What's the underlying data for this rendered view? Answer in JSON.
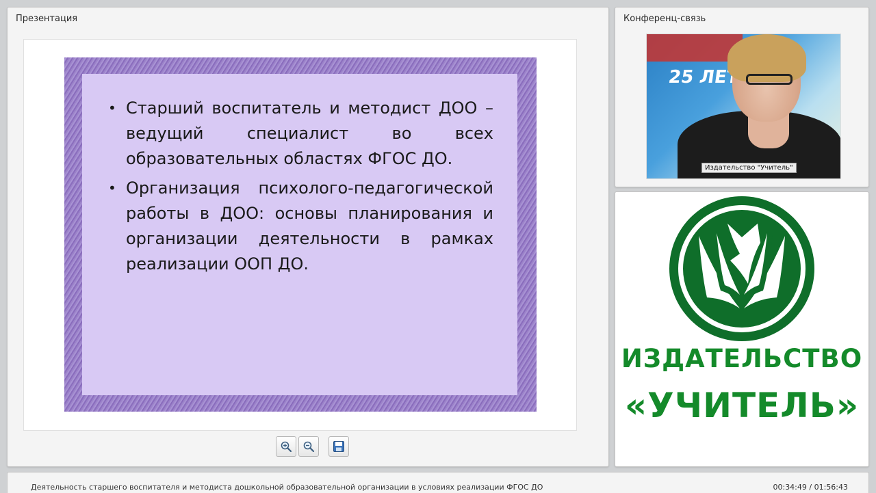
{
  "presentation": {
    "title": "Презентация",
    "slide": {
      "bullets": [
        "Старший воспитатель и методист ДОО – ведущий специалист во всех образовательных областях ФГОС ДО.",
        "Организация психолого-педагогической работы в ДОО: основы планирования и организации деятельности в рамках реализации ООП ДО."
      ]
    },
    "toolbar": {
      "zoom_in_icon": "zoom-in-icon",
      "zoom_out_icon": "zoom-out-icon",
      "save_icon": "floppy-disk-icon"
    }
  },
  "conference": {
    "title": "Конференц-связь",
    "video_banner": "25 ЛЕТ",
    "video_caption": "Издательство \"Учитель\""
  },
  "logo": {
    "line1": "ИЗДАТЕЛЬСТВО",
    "line2": "«УЧИТЕЛЬ»",
    "color": "#148a2a"
  },
  "footer": {
    "lecture_title": "Деятельность старшего воспитателя и методиста дошкольной образовательной организации в условиях реализации ФГОС ДО",
    "timecode": "00:34:49 / 01:56:43"
  }
}
